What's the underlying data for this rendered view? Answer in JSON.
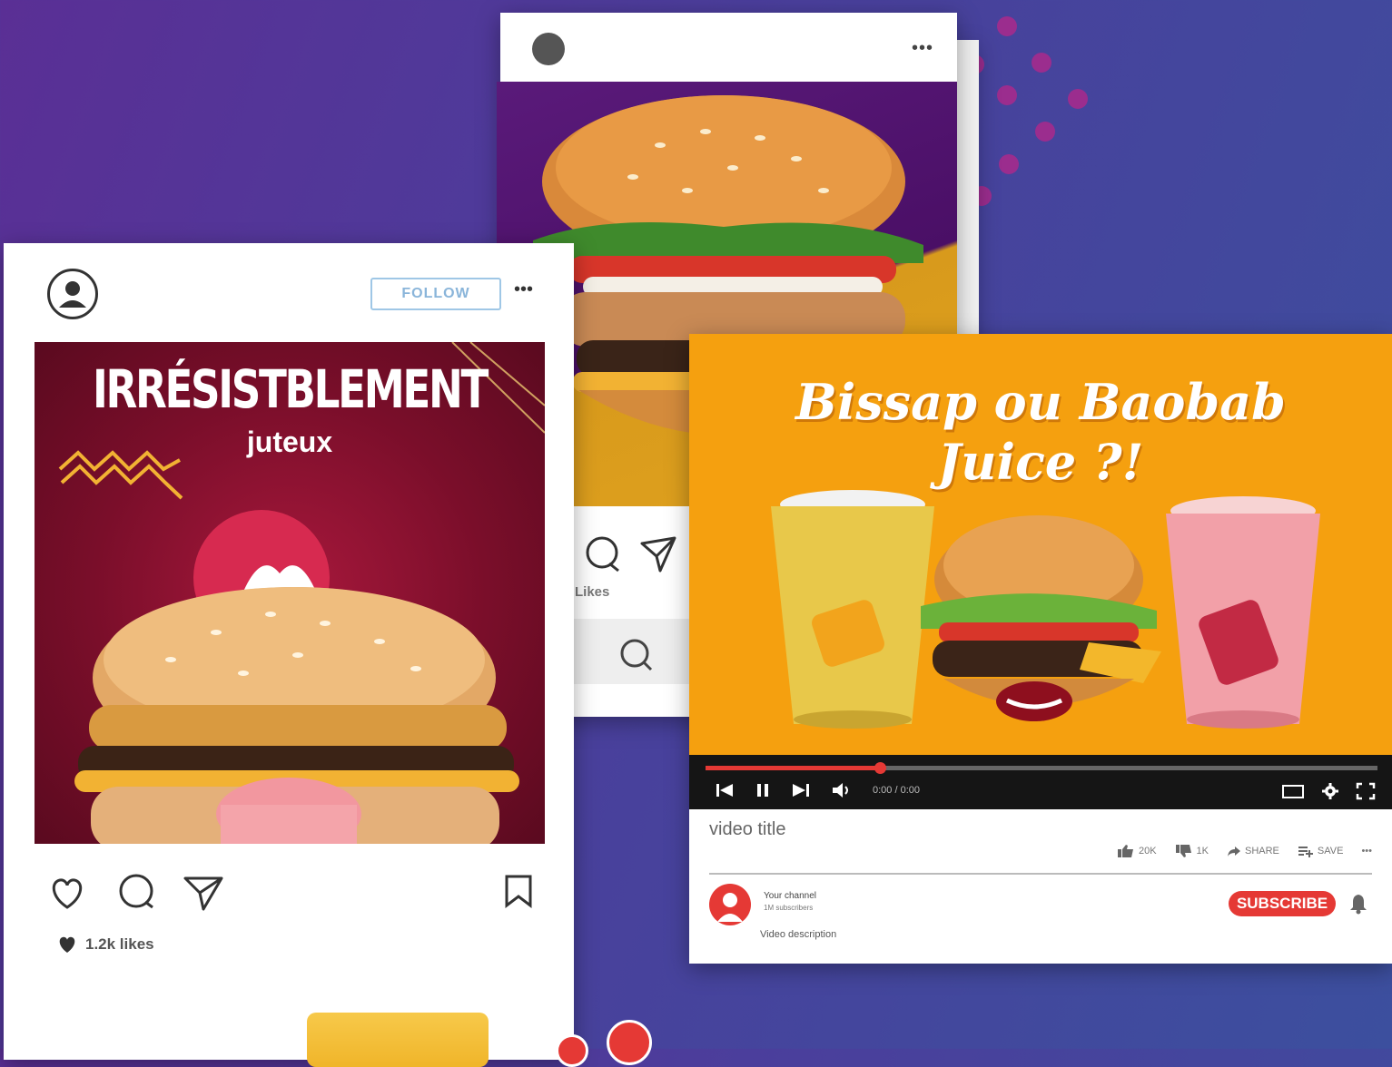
{
  "front_post": {
    "follow_label": "FOLLOW",
    "more_label": "•••",
    "headline": "IRRÉSISTBLEMENT",
    "subheadline": "juteux",
    "likes": "1.2k likes"
  },
  "back_post": {
    "more_label": "•••",
    "likes": "Likes"
  },
  "youtube": {
    "thumbnail_title_line1": "Bissap ou Baobab",
    "thumbnail_title_line2": "Juice ?!",
    "time": "0:00 / 0:00",
    "progress": 0.26,
    "video_title": "video title",
    "likes": "20K",
    "dislikes": "1K",
    "share_label": "SHARE",
    "save_label": "SAVE",
    "more_label": "•••",
    "channel_name": "Your channel",
    "channel_subs": "1M subscribers",
    "description": "Video description",
    "subscribe_label": "SUBSCRIBE"
  },
  "colors": {
    "background_start": "#5a2f95",
    "background_end": "#3c4f9e",
    "accent_red": "#e53935",
    "thumb_orange": "#f5a00f",
    "post_maroon": "#7a0e2a"
  }
}
